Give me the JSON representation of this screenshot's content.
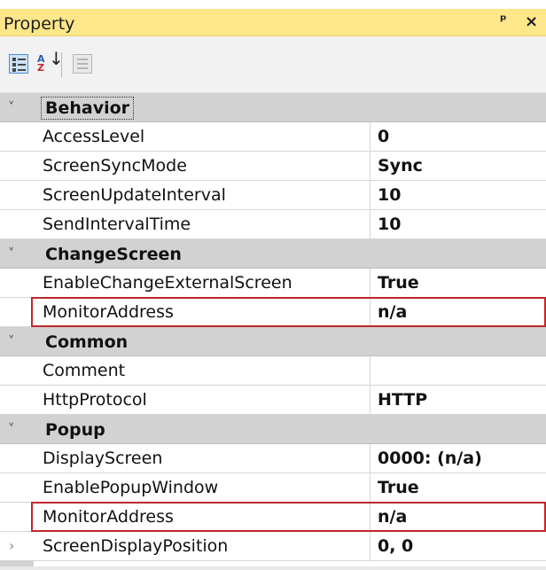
{
  "panel": {
    "title": "Property",
    "pin_glyph": "ꟷ",
    "close_glyph": "×",
    "toolbar": {
      "categorized_icon": "categorized-view-icon",
      "alphabetical_label": "A\nZ",
      "alphabetical_arrow": "↓",
      "pages_icon": "property-pages-icon"
    }
  },
  "categories": [
    {
      "name": "Behavior",
      "chevron": "˅",
      "properties": [
        {
          "name": "AccessLevel",
          "value": "0"
        },
        {
          "name": "ScreenSyncMode",
          "value": "Sync"
        },
        {
          "name": "ScreenUpdateInterval",
          "value": "10"
        },
        {
          "name": "SendIntervalTime",
          "value": "10"
        }
      ]
    },
    {
      "name": "ChangeScreen",
      "chevron": "˅",
      "properties": [
        {
          "name": "EnableChangeExternalScreen",
          "value": "True"
        },
        {
          "name": "MonitorAddress",
          "value": "n/a"
        }
      ]
    },
    {
      "name": "Common",
      "chevron": "˅",
      "properties": [
        {
          "name": "Comment",
          "value": ""
        },
        {
          "name": "HttpProtocol",
          "value": "HTTP"
        }
      ]
    },
    {
      "name": "Popup",
      "chevron": "˅",
      "properties": [
        {
          "name": "DisplayScreen",
          "value": "0000: (n/a)"
        },
        {
          "name": "EnablePopupWindow",
          "value": "True"
        },
        {
          "name": "MonitorAddress",
          "value": "n/a"
        },
        {
          "name": "ScreenDisplayPosition",
          "value": "0, 0",
          "expander": "›"
        }
      ]
    }
  ],
  "colors": {
    "title_bar": "#fde78a",
    "category_background": "#d2d2d2",
    "highlight_border": "#c0262d"
  }
}
